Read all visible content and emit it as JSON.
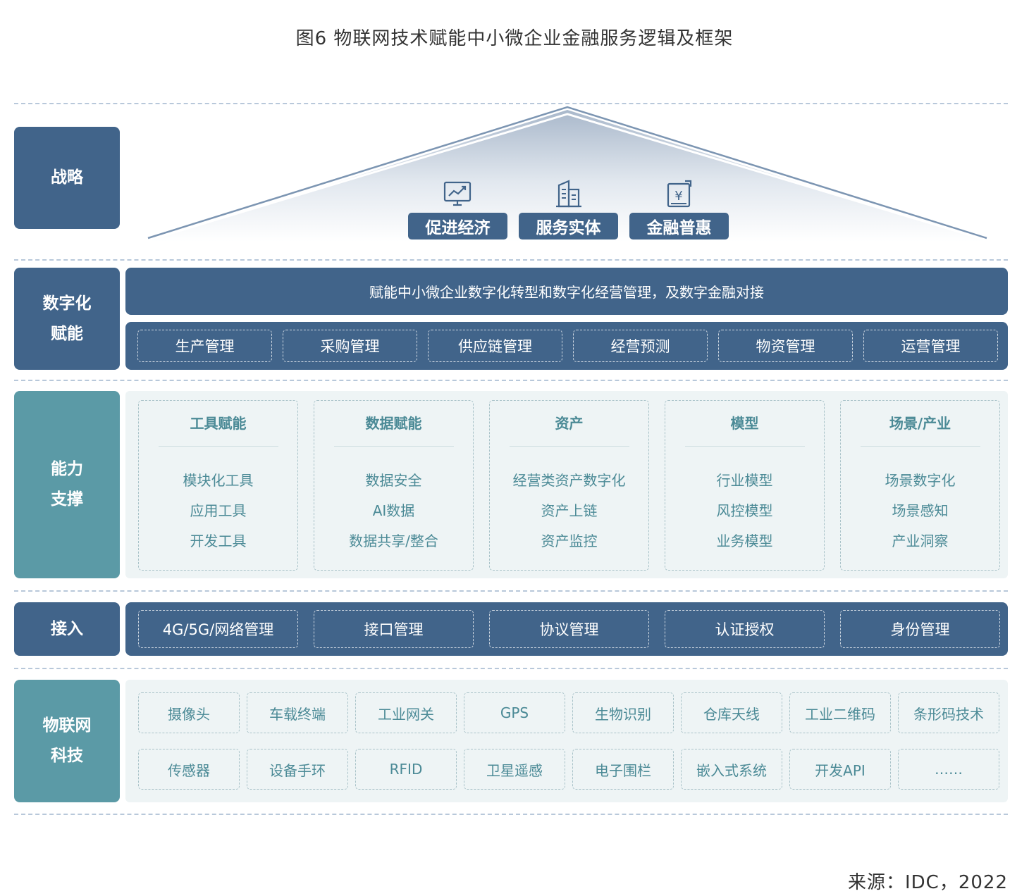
{
  "title": "图6 物联网技术赋能中小微企业金融服务逻辑及框架",
  "source": "来源：IDC，2022",
  "layers": {
    "strategy": {
      "label": "战略",
      "pillars": [
        {
          "label": "促进经济",
          "icon": "chart-monitor-icon"
        },
        {
          "label": "服务实体",
          "icon": "building-icon"
        },
        {
          "label": "金融普惠",
          "icon": "yen-document-icon"
        }
      ]
    },
    "digital": {
      "label": "数字化\n赋能",
      "banner": "赋能中小微企业数字化转型和数字化经营管理，及数字金融对接",
      "items": [
        "生产管理",
        "采购管理",
        "供应链管理",
        "经营预测",
        "物资管理",
        "运营管理"
      ]
    },
    "capability": {
      "label": "能力\n支撑",
      "columns": [
        {
          "title": "工具赋能",
          "items": [
            "模块化工具",
            "应用工具",
            "开发工具"
          ]
        },
        {
          "title": "数据赋能",
          "items": [
            "数据安全",
            "AI数据",
            "数据共享/整合"
          ]
        },
        {
          "title": "资产",
          "items": [
            "经营类资产数字化",
            "资产上链",
            "资产监控"
          ]
        },
        {
          "title": "模型",
          "items": [
            "行业模型",
            "风控模型",
            "业务模型"
          ]
        },
        {
          "title": "场景/产业",
          "items": [
            "场景数字化",
            "场景感知",
            "产业洞察"
          ]
        }
      ]
    },
    "access": {
      "label": "接入",
      "items": [
        "4G/5G/网络管理",
        "接口管理",
        "协议管理",
        "认证授权",
        "身份管理"
      ]
    },
    "iot": {
      "label": "物联网\n科技",
      "row1": [
        "摄像头",
        "车载终端",
        "工业网关",
        "GPS",
        "生物识别",
        "仓库天线",
        "工业二维码",
        "条形码技术"
      ],
      "row2": [
        "传感器",
        "设备手环",
        "RFID",
        "卫星遥感",
        "电子围栏",
        "嵌入式系统",
        "开发API",
        "……"
      ]
    }
  },
  "colors": {
    "navy": "#41648a",
    "teal": "#5b9aa6",
    "panel": "#eef4f5",
    "dash": "#b8c8da"
  }
}
